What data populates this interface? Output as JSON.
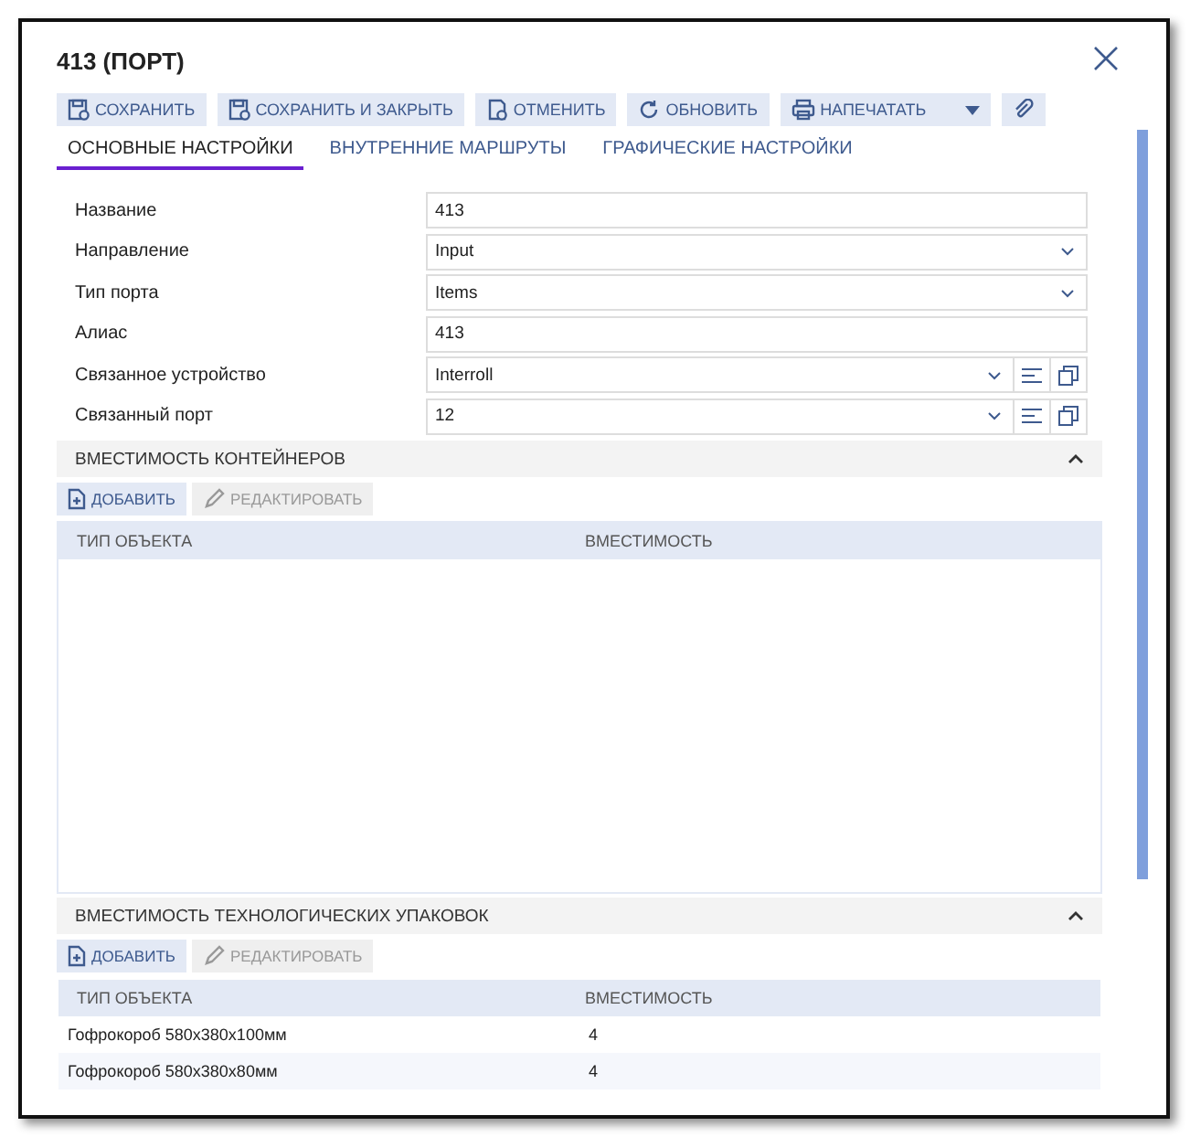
{
  "window": {
    "title": "413 (ПОРТ)"
  },
  "toolbar": [
    {
      "kind": "button",
      "label": "СОХРАНИТЬ"
    },
    {
      "kind": "button",
      "label": "СОХРАНИТЬ И ЗАКРЫТЬ"
    },
    {
      "kind": "button",
      "label": "ОТМЕНИТЬ"
    },
    {
      "kind": "button",
      "label": "ОБНОВИТЬ"
    },
    {
      "kind": "split",
      "label": "НАПЕЧАТАТЬ"
    },
    {
      "kind": "icon"
    }
  ],
  "tabs": [
    {
      "label": "ОСНОВНЫЕ НАСТРОЙКИ",
      "selected": true
    },
    {
      "label": "ВНУТРЕННИЕ МАРШРУТЫ",
      "selected": false
    },
    {
      "label": "ГРАФИЧЕСКИЕ НАСТРОЙКИ",
      "selected": false
    }
  ],
  "fields": [
    {
      "label": "Название",
      "kind": "text",
      "value": "413"
    },
    {
      "label": "Направление",
      "kind": "select",
      "value": "Input"
    },
    {
      "label": "Тип порта",
      "kind": "select",
      "value": "Items"
    },
    {
      "label": "Алиас",
      "kind": "text",
      "value": "413"
    },
    {
      "label": "Связанное устройство",
      "kind": "lookup",
      "value": "Interroll"
    },
    {
      "label": "Связанный порт",
      "kind": "lookup",
      "value": "12"
    }
  ],
  "sections": [
    {
      "title": "ВМЕСТИМОСТЬ КОНТЕЙНЕРОВ",
      "expanded": true,
      "buttons": [
        {
          "label": "ДОБАВИТЬ",
          "disabled": false
        },
        {
          "label": "РЕДАКТИРОВАТЬ",
          "disabled": true
        }
      ],
      "columns": [
        "ТИП ОБЪЕКТА",
        "ВМЕСТИМОСТЬ"
      ]
    },
    {
      "title": "ВМЕСТИМОСТЬ ТЕХНОЛОГИЧЕСКИХ УПАКОВОК",
      "expanded": true,
      "buttons": [
        {
          "label": "ДОБАВИТЬ",
          "disabled": false
        },
        {
          "label": "РЕДАКТИРОВАТЬ",
          "disabled": true
        }
      ],
      "columns": [
        "ТИП ОБЪЕКТА",
        "ВМЕСТИМОСТЬ"
      ],
      "rows": [
        [
          "Гофрокороб 580x380x100мм",
          "4"
        ],
        [
          "Гофрокороб 580x380x80мм",
          "4"
        ]
      ]
    }
  ]
}
